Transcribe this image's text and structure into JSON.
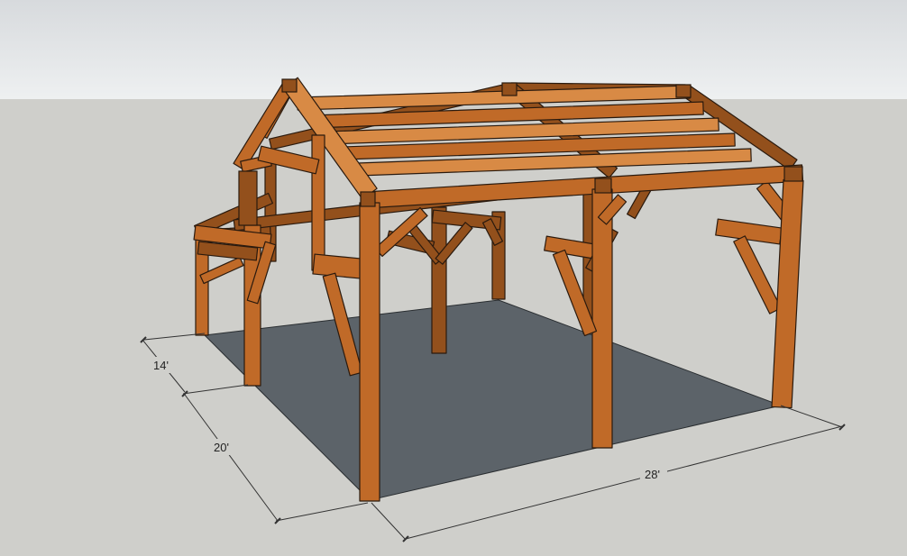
{
  "colors": {
    "sky_top": "#d7dadd",
    "sky_bottom": "#eef0f1",
    "ground": "#cfcfcb",
    "slab": "#5c6369",
    "timber": "#c06a28",
    "timber_dark": "#93501c",
    "timber_light": "#d88a45",
    "edge": "#2a1a0e",
    "dim_line": "#333333"
  },
  "dimensions": {
    "side_extension": "14'",
    "width": "20'",
    "length": "28'"
  }
}
